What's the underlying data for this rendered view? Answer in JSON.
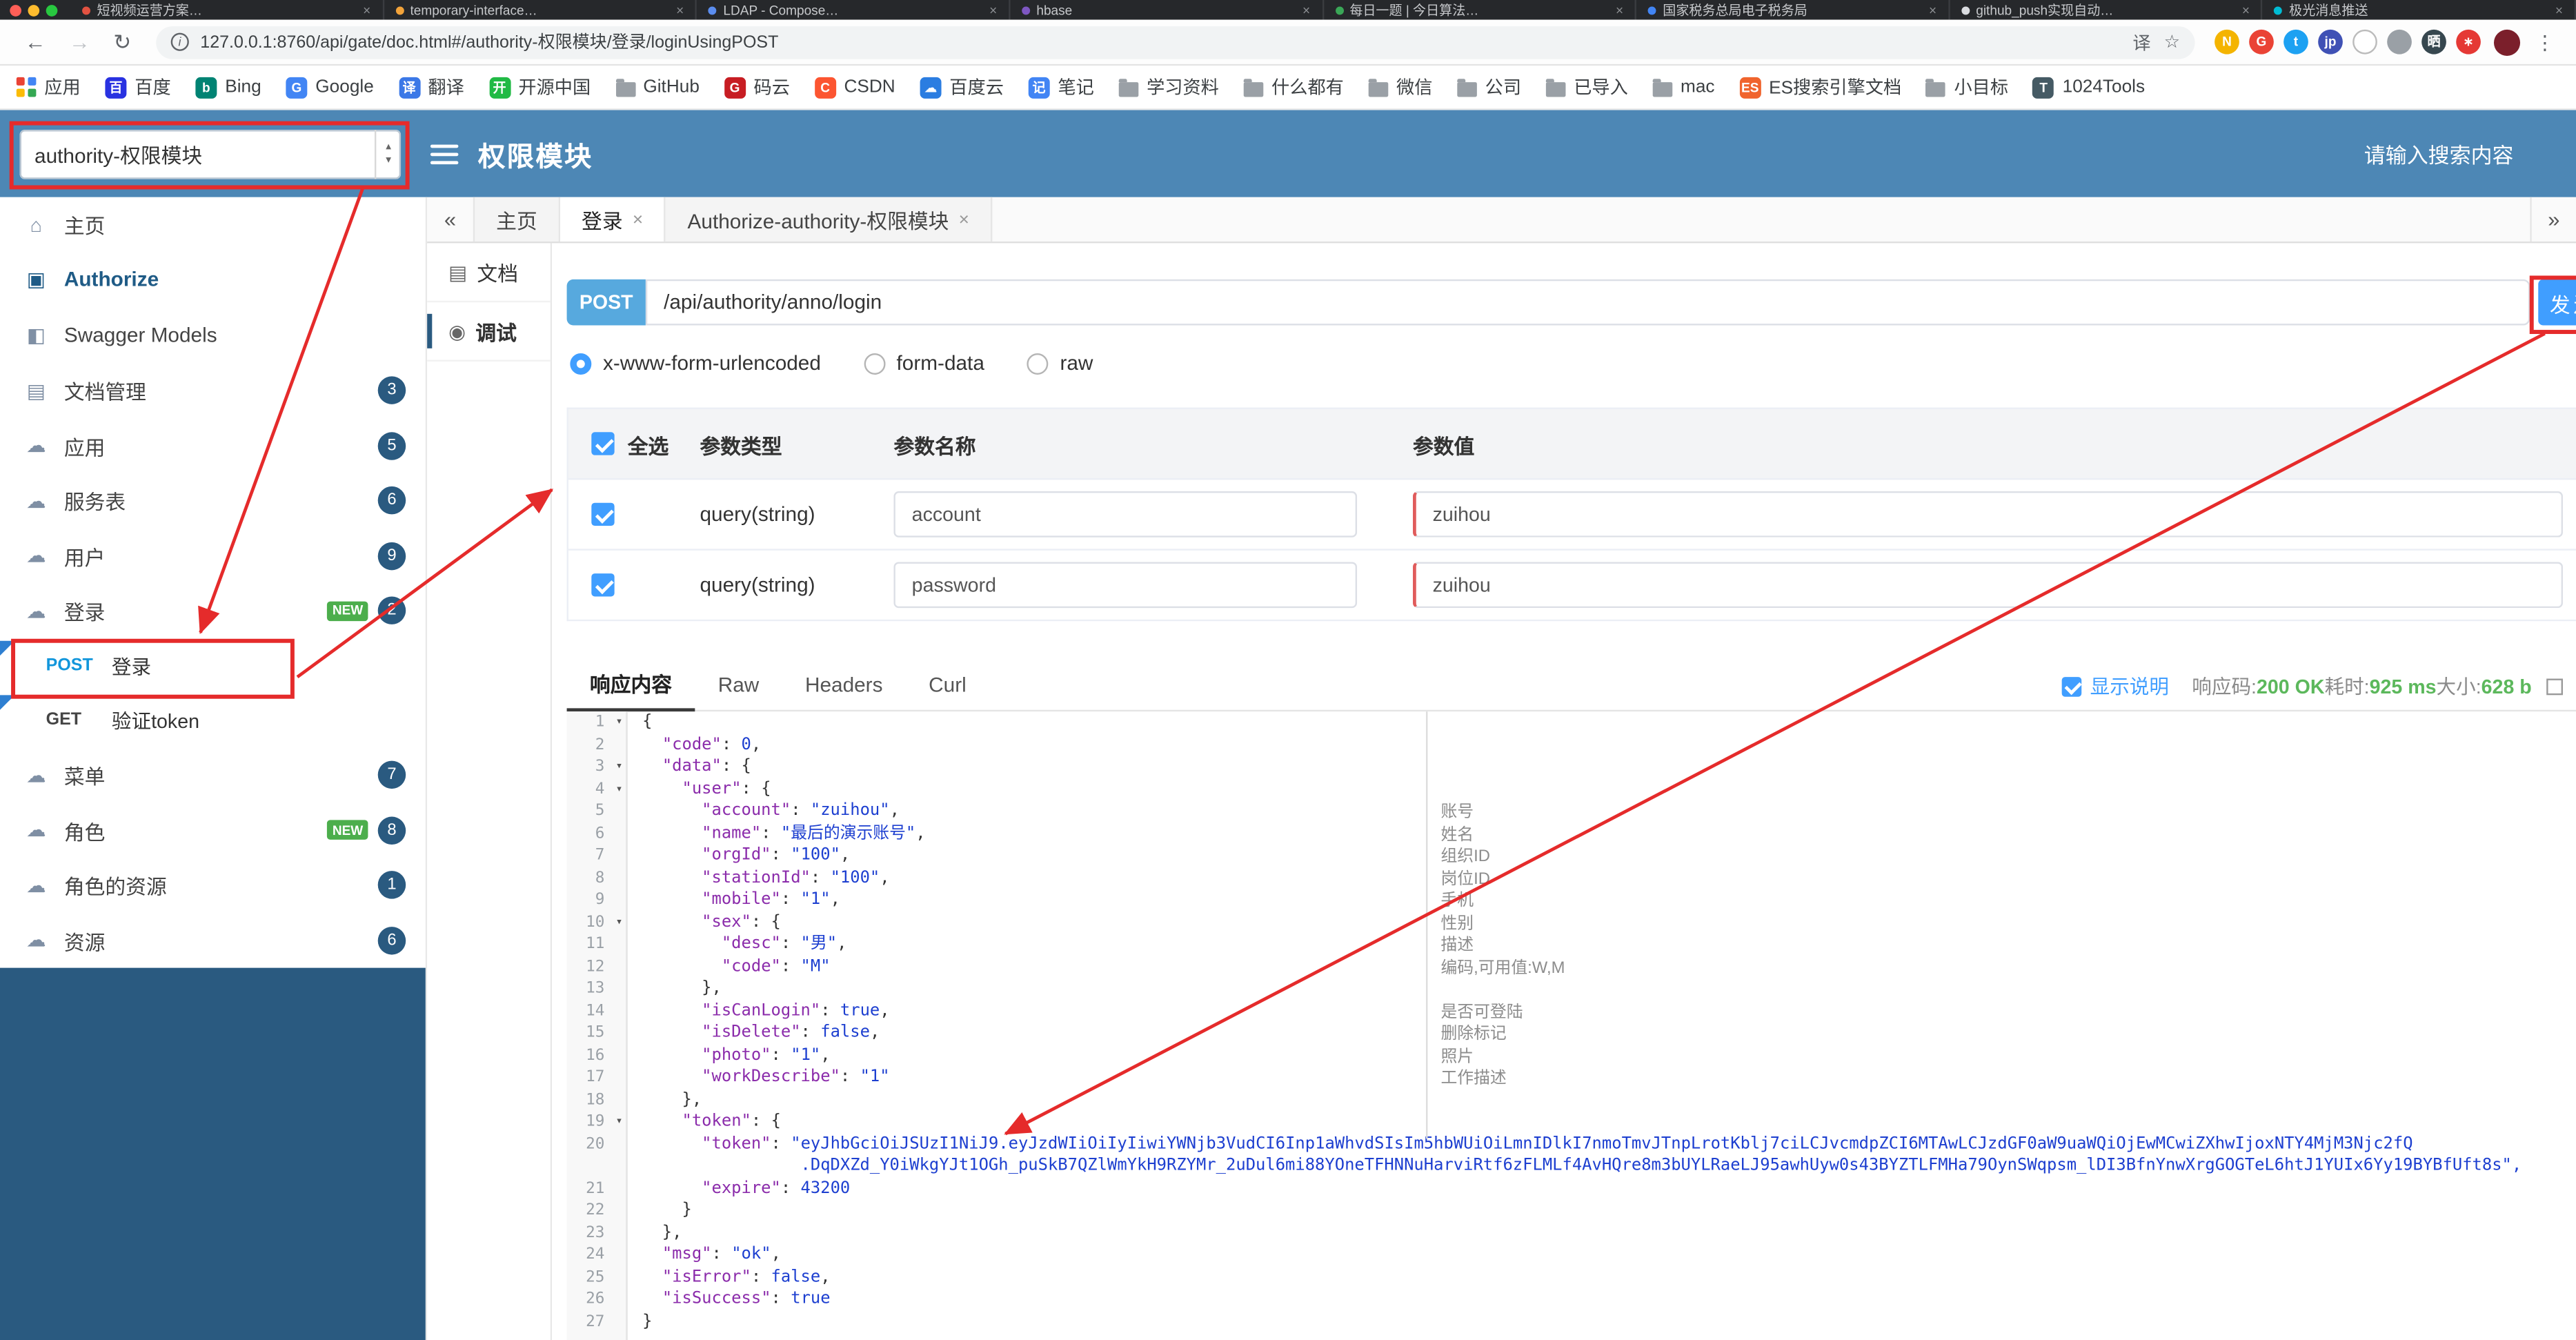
{
  "browser": {
    "tabs": [
      {
        "label": "短视频运营方案…",
        "color": "#e25241"
      },
      {
        "label": "temporary-interface…",
        "color": "#f2a33a"
      },
      {
        "label": "LDAP - Compose…",
        "color": "#5b8def"
      },
      {
        "label": "hbase",
        "color": "#7e57c2"
      },
      {
        "label": "每日一题 | 今日算法…",
        "color": "#3aa757"
      },
      {
        "label": "国家税务总局电子税务局",
        "color": "#4285f4"
      },
      {
        "label": "github_push实现自动…",
        "color": "#dadce0"
      },
      {
        "label": "极光消息推送",
        "color": "#00bcd4"
      }
    ],
    "address": {
      "url": "127.0.0.1:8760/api/gate/doc.html#/authority-权限模块/登录/loginUsingPOST"
    },
    "extensions": [
      {
        "name": "notes-extension-icon",
        "glyph": "N",
        "bg": "#f4b400"
      },
      {
        "name": "google-extension-icon",
        "glyph": "G",
        "bg": "#ea4335"
      },
      {
        "name": "twitter-extension-icon",
        "glyph": "t",
        "bg": "#1da1f2"
      },
      {
        "name": "jp-extension-icon",
        "glyph": "jp",
        "bg": "#3f51b5"
      },
      {
        "name": "ring-extension-icon",
        "glyph": "",
        "bg": "#ffffff",
        "border": true
      },
      {
        "name": "shield-extension-icon",
        "glyph": "",
        "bg": "#9aa0a6"
      },
      {
        "name": "screenshot-extension-icon",
        "glyph": "晒",
        "bg": "#37474f"
      },
      {
        "name": "asterisk-extension-icon",
        "glyph": "∗",
        "bg": "#e53935"
      }
    ],
    "bookmarks": [
      {
        "label": "应用",
        "kind": "apps"
      },
      {
        "label": "百度",
        "kind": "letter",
        "glyph": "百",
        "bg": "#2932e1"
      },
      {
        "label": "Bing",
        "kind": "letter",
        "glyph": "b",
        "bg": "#008373"
      },
      {
        "label": "Google",
        "kind": "letter",
        "glyph": "G",
        "bg": "#4285f4"
      },
      {
        "label": "翻译",
        "kind": "letter",
        "glyph": "译",
        "bg": "#3b78e7"
      },
      {
        "label": "开源中国",
        "kind": "letter",
        "glyph": "开",
        "bg": "#21ba45"
      },
      {
        "label": "GitHub",
        "kind": "folder"
      },
      {
        "label": "码云",
        "kind": "letter",
        "glyph": "G",
        "bg": "#c71d23"
      },
      {
        "label": "CSDN",
        "kind": "letter",
        "glyph": "C",
        "bg": "#fc5531"
      },
      {
        "label": "百度云",
        "kind": "letter",
        "glyph": "☁",
        "bg": "#2b7de1"
      },
      {
        "label": "笔记",
        "kind": "letter",
        "glyph": "记",
        "bg": "#4285f4"
      },
      {
        "label": "学习资料",
        "kind": "folder"
      },
      {
        "label": "什么都有",
        "kind": "folder"
      },
      {
        "label": "微信",
        "kind": "folder"
      },
      {
        "label": "公司",
        "kind": "folder"
      },
      {
        "label": "已导入",
        "kind": "folder"
      },
      {
        "label": "mac",
        "kind": "folder"
      },
      {
        "label": "ES搜索引擎文档",
        "kind": "letter",
        "glyph": "ES",
        "bg": "#f0642d"
      },
      {
        "label": "小目标",
        "kind": "folder"
      },
      {
        "label": "1024Tools",
        "kind": "letter",
        "glyph": "T",
        "bg": "#455a64"
      }
    ]
  },
  "icons": {
    "back": "←",
    "forward": "→",
    "reload": "↻",
    "star": "☆",
    "kebab": "⋮",
    "scroll_left": "«",
    "scroll_right": "»",
    "stepper_up": "▴",
    "stepper_down": "▾",
    "close": "×",
    "info": "i",
    "translate": "译",
    "fold": "▾",
    "doc": "▤",
    "debug": "◉",
    "doc_rail": "▤"
  },
  "header": {
    "select_value": "authority-权限模块",
    "title": "权限模块",
    "search_placeholder": "请输入搜索内容"
  },
  "sidebar": {
    "icon_glyphs": {
      "home": "⌂",
      "auth": "▣",
      "models": "◧",
      "doc": "▤",
      "cloud": "☁"
    },
    "items": [
      {
        "label": "主页",
        "icon": "home"
      },
      {
        "label": "Authorize",
        "icon": "auth",
        "authorize": true
      },
      {
        "label": "Swagger Models",
        "icon": "models"
      },
      {
        "label": "文档管理",
        "icon": "doc",
        "badge": "3"
      },
      {
        "label": "应用",
        "icon": "cloud",
        "badge": "5"
      },
      {
        "label": "服务表",
        "icon": "cloud",
        "badge": "6"
      },
      {
        "label": "用户",
        "icon": "cloud",
        "badge": "9"
      },
      {
        "label": "登录",
        "icon": "cloud",
        "badge": "2",
        "new": true
      },
      {
        "label": "登录",
        "method": "POST"
      },
      {
        "label": "验证token",
        "method": "GET"
      },
      {
        "label": "菜单",
        "icon": "cloud",
        "badge": "7"
      },
      {
        "label": "角色",
        "icon": "cloud",
        "badge": "8",
        "new": true
      },
      {
        "label": "角色的资源",
        "icon": "cloud",
        "badge": "1"
      },
      {
        "label": "资源",
        "icon": "cloud",
        "badge": "6"
      }
    ]
  },
  "doc_tabs": {
    "items": [
      {
        "label": "主页",
        "closable": false,
        "active": false
      },
      {
        "label": "登录",
        "closable": true,
        "active": true
      },
      {
        "label": "Authorize-authority-权限模块",
        "closable": true,
        "active": false
      }
    ]
  },
  "rail": {
    "doc_label": "文档",
    "debug_label": "调试"
  },
  "debug": {
    "method_label": "POST",
    "url": "/api/authority/anno/login",
    "send_label": "发送",
    "content_types": [
      {
        "label": "x-www-form-urlencoded",
        "selected": true
      },
      {
        "label": "form-data",
        "selected": false
      },
      {
        "label": "raw",
        "selected": false
      }
    ],
    "table": {
      "header": {
        "select_all": "全选",
        "type": "参数类型",
        "name": "参数名称",
        "value": "参数值"
      },
      "rows": [
        {
          "checked": true,
          "type": "query(string)",
          "name": "account",
          "value": "zuihou"
        },
        {
          "checked": true,
          "type": "query(string)",
          "name": "password",
          "value": "zuihou"
        }
      ]
    }
  },
  "response": {
    "tabs": [
      {
        "label": "响应内容",
        "active": true
      },
      {
        "label": "Raw",
        "active": false
      },
      {
        "label": "Headers",
        "active": false
      },
      {
        "label": "Curl",
        "active": false
      }
    ],
    "show_desc_label": "显示说明",
    "meta": {
      "code_label": "响应码:",
      "code_value": "200 OK",
      "time_label": "耗时:",
      "time_value": "925 ms",
      "size_label": "大小:",
      "size_value": "628 b"
    }
  },
  "editor": {
    "rows": [
      {
        "n": "1",
        "fold": true,
        "text": "{"
      },
      {
        "n": "2",
        "text": "  \"code\": 0,"
      },
      {
        "n": "3",
        "fold": true,
        "text": "  \"data\": {"
      },
      {
        "n": "4",
        "fold": true,
        "text": "    \"user\": {"
      },
      {
        "n": "5",
        "text": "      \"account\": \"zuihou\","
      },
      {
        "n": "6",
        "text": "      \"name\": \"最后的演示账号\","
      },
      {
        "n": "7",
        "text": "      \"orgId\": \"100\","
      },
      {
        "n": "8",
        "text": "      \"stationId\": \"100\","
      },
      {
        "n": "9",
        "text": "      \"mobile\": \"1\","
      },
      {
        "n": "10",
        "fold": true,
        "text": "      \"sex\": {"
      },
      {
        "n": "11",
        "text": "        \"desc\": \"男\","
      },
      {
        "n": "12",
        "text": "        \"code\": \"M\""
      },
      {
        "n": "13",
        "text": "      },"
      },
      {
        "n": "14",
        "text": "      \"isCanLogin\": true,"
      },
      {
        "n": "15",
        "text": "      \"isDelete\": false,"
      },
      {
        "n": "16",
        "text": "      \"photo\": \"1\","
      },
      {
        "n": "17",
        "text": "      \"workDescribe\": \"1\""
      },
      {
        "n": "18",
        "text": "    },"
      },
      {
        "n": "19",
        "fold": true,
        "text": "    \"token\": {"
      },
      {
        "n": "20",
        "text": "      \"token\": \"eyJhbGciOiJSUzI1NiJ9.eyJzdWIiOiIyIiwiYWNjb3VudCI6Inp1aWhvdSIsIm5hbWUiOiLmnIDlkI7nmoTmvJTnpLrotKblj7ciLCJvcmdpZCI6MTAwLCJzdGF0aW9uaWQiOjEwMCwiZXhwIjoxNTY4MjM3Njc2fQ"
      },
      {
        "n": "",
        "cls": "str",
        "text": "                .DqDXZd_Y0iWkgYJt1OGh_puSkB7QZlWmYkH9RZYMr_2uDul6mi88YOneTFHNNuHarviRtf6zFLMLf4AvHQre8m3bUYLRaeLJ95awhUyw0s43BYZTLFMHa79OynSWqpsm_lDI3BfnYnwXrgGOGTeL6htJ1YUIx6Yy19BYBfUft8s\","
      },
      {
        "n": "21",
        "text": "      \"expire\": 43200"
      },
      {
        "n": "22",
        "text": "    }"
      },
      {
        "n": "23",
        "text": "  },"
      },
      {
        "n": "24",
        "text": "  \"msg\": \"ok\","
      },
      {
        "n": "25",
        "text": "  \"isError\": false,"
      },
      {
        "n": "26",
        "text": "  \"isSuccess\": true"
      },
      {
        "n": "27",
        "text": "}"
      }
    ],
    "annotations": [
      {
        "row": 4,
        "text": "账号"
      },
      {
        "row": 5,
        "text": "姓名"
      },
      {
        "row": 6,
        "text": "组织ID"
      },
      {
        "row": 7,
        "text": "岗位ID"
      },
      {
        "row": 8,
        "text": "手机"
      },
      {
        "row": 9,
        "text": "性别"
      },
      {
        "row": 10,
        "text": "描述"
      },
      {
        "row": 11,
        "text": "编码,可用值:W,M"
      },
      {
        "row": 13,
        "text": "是否可登陆"
      },
      {
        "row": 14,
        "text": "删除标记"
      },
      {
        "row": 15,
        "text": "照片"
      },
      {
        "row": 16,
        "text": "工作描述"
      }
    ]
  }
}
